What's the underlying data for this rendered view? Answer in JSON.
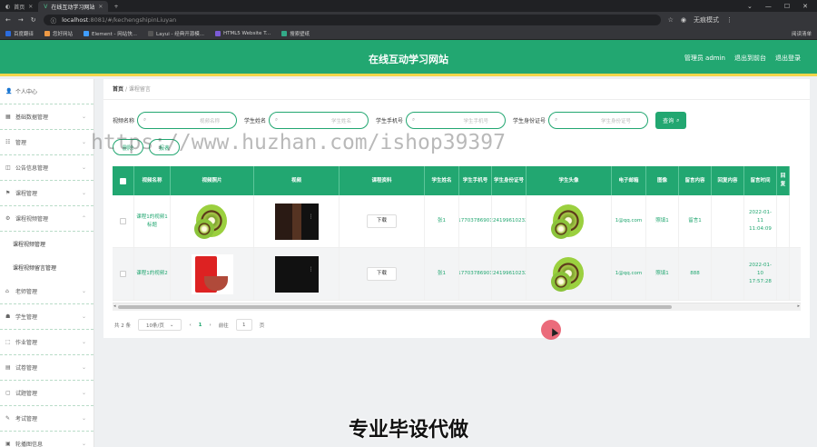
{
  "browser": {
    "tabs": [
      {
        "title": "首页",
        "active": false
      },
      {
        "title": "在线互动学习网站",
        "active": true
      }
    ],
    "new_tab": "+",
    "url_host": "localhost",
    "url_rest": ":8081/#/kechengshipinLiuyan",
    "profile": "无痕模式",
    "bookmarks": [
      "百度翻译",
      "您好网站",
      "Element - 网站快...",
      "Layui - 经典开源模...",
      "HTML5 Website T...",
      "搜索壁纸"
    ],
    "reading_list": "阅读清单"
  },
  "header": {
    "title": "在线互动学习网站",
    "nav": [
      "管理员 admin",
      "退出到前台",
      "退出登录"
    ]
  },
  "sidebar": {
    "items": [
      {
        "label": "个人中心",
        "icon": "user-icon"
      },
      {
        "label": "基础数据管理",
        "icon": "grid-icon"
      },
      {
        "label": "管理",
        "icon": "list-icon"
      },
      {
        "label": "公告信息管理",
        "icon": "bell-icon"
      },
      {
        "label": "课程管理",
        "icon": "book-icon"
      },
      {
        "label": "课程视频管理",
        "icon": "video-icon"
      }
    ],
    "sub_items": [
      "课程视频管理",
      "课程视频留言管理"
    ],
    "items_after": [
      {
        "label": "老师管理",
        "icon": "teacher-icon"
      },
      {
        "label": "学生管理",
        "icon": "student-icon"
      },
      {
        "label": "作业管理",
        "icon": "homework-icon"
      },
      {
        "label": "试卷管理",
        "icon": "paper-icon"
      },
      {
        "label": "试题管理",
        "icon": "question-icon"
      },
      {
        "label": "考试管理",
        "icon": "exam-icon"
      },
      {
        "label": "轮播图信息",
        "icon": "image-icon"
      }
    ]
  },
  "breadcrumb": {
    "home": "首页",
    "sep": "/",
    "current": "课程留言"
  },
  "search": {
    "fields": [
      {
        "label": "视频名称",
        "placeholder": "视频名称"
      },
      {
        "label": "学生姓名",
        "placeholder": "学生姓名"
      },
      {
        "label": "学生手机号",
        "placeholder": "学生手机号"
      },
      {
        "label": "学生身份证号",
        "placeholder": "学生身份证号"
      }
    ],
    "button": "查询"
  },
  "actions": {
    "btn1": "删除",
    "btn2": "报表"
  },
  "table": {
    "columns": [
      "视频名称",
      "视频照片",
      "视频",
      "课程资料",
      "学生姓名",
      "学生手机号",
      "学生身份证号",
      "学生头像",
      "电子邮箱",
      "图像",
      "留言内容",
      "回复内容",
      "留言时间",
      "回复"
    ],
    "rows": [
      {
        "name": "课程1的视频1标题",
        "photo": "kiwi",
        "download": "下载",
        "student": "张1",
        "phone": "17703786901",
        "idcard": "410224199610232001",
        "email": "1@qq.com",
        "image": "照填1",
        "message": "留言1",
        "reply": "",
        "time": "2022-01-11 11:04:09"
      },
      {
        "name": "课程1的视频2",
        "photo": "pkg",
        "download": "下载",
        "student": "张1",
        "phone": "17703786901",
        "idcard": "410224199610232001",
        "email": "1@qq.com",
        "image": "照填1",
        "message": "888",
        "reply": "",
        "time": "2022-01-10 17:57:28"
      }
    ]
  },
  "pager": {
    "total": "共 2 条",
    "size": "10条/页",
    "prev": "‹",
    "page": "1",
    "next": "›",
    "goto": "前往",
    "goto_val": "1",
    "unit": "页"
  },
  "watermark": "https://www.huzhan.com/ishop39397",
  "banner": "专业毕设代做",
  "colors": {
    "primary": "#22a771",
    "accent": "#f4d64a"
  }
}
